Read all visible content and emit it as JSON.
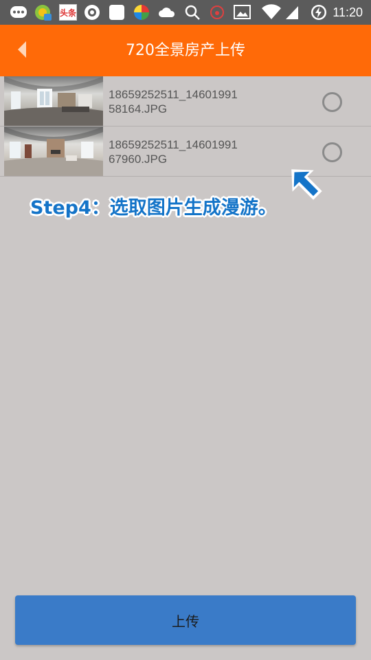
{
  "status_bar": {
    "time": "11:20",
    "icons": [
      "message-icon",
      "app-icon",
      "toutiao-icon",
      "browser-icon",
      "app-square-icon",
      "game-icon",
      "cloud-icon",
      "search-icon",
      "weibo-icon",
      "image-icon",
      "wifi-icon",
      "signal-icon",
      "battery-charging-icon"
    ],
    "toutiao_label": "头条"
  },
  "header": {
    "title": "720全景房产上传",
    "background_color": "#ff6a08",
    "back_icon": "back-arrow-icon"
  },
  "files": [
    {
      "name": "18659252511_1460199158164.JPG",
      "selected": false
    },
    {
      "name": "18659252511_1460199167960.JPG",
      "selected": false
    }
  ],
  "hint": {
    "text": "Step4：选取图片生成漫游。",
    "color": "#1474c8",
    "arrow_icon": "pointer-arrow-icon"
  },
  "upload_button": {
    "label": "上传",
    "color": "#3a7bc8"
  }
}
